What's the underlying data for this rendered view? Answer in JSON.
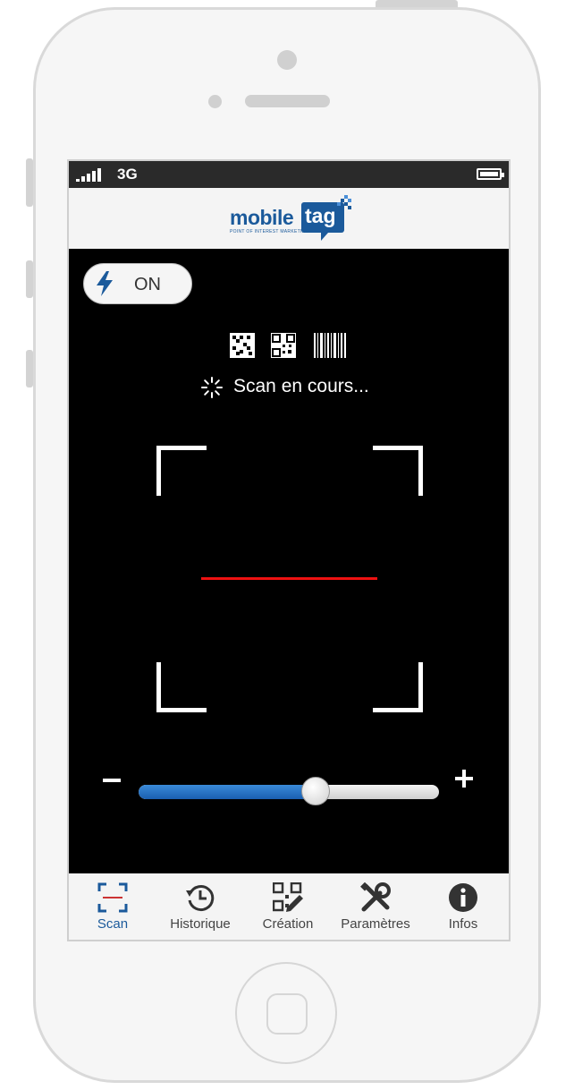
{
  "status_bar": {
    "network": "3G"
  },
  "logo": {
    "brand_left": "mobile",
    "brand_right": "tag",
    "tagline": "POINT OF INTEREST MARKETING"
  },
  "flash": {
    "label": "ON",
    "icon": "lightning-bolt-icon"
  },
  "scan": {
    "code_types": [
      "datamatrix-icon",
      "qr-code-icon",
      "barcode-icon"
    ],
    "status_text": "Scan en cours...",
    "spinner_icon": "loading-spinner-icon"
  },
  "zoom": {
    "minus_label": "–",
    "plus_label": "+",
    "level": 0.59
  },
  "tabs": [
    {
      "label": "Scan",
      "icon": "scan-frame-icon",
      "active": true
    },
    {
      "label": "Historique",
      "icon": "history-clock-icon",
      "active": false
    },
    {
      "label": "Création",
      "icon": "qr-edit-icon",
      "active": false
    },
    {
      "label": "Paramètres",
      "icon": "tools-icon",
      "active": false
    },
    {
      "label": "Infos",
      "icon": "info-icon",
      "active": false
    }
  ],
  "colors": {
    "accent": "#1b5a9b",
    "laser": "#e11111",
    "slider_fill": "#2a75c8"
  }
}
